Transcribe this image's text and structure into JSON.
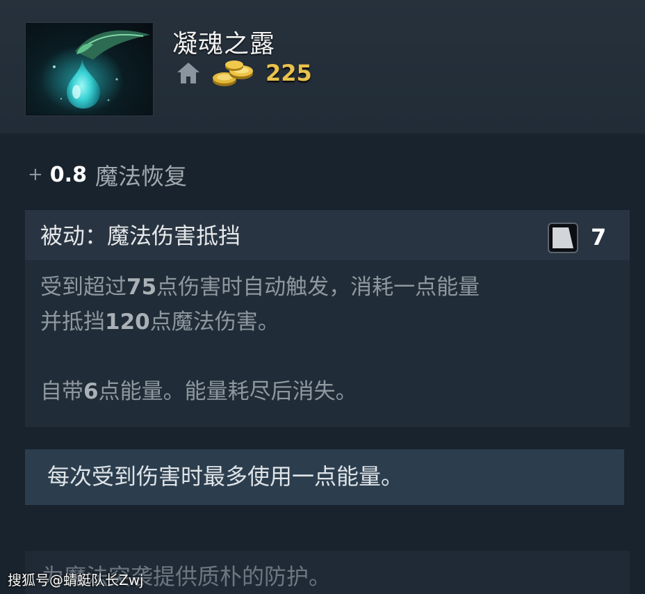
{
  "item": {
    "name": "凝魂之露",
    "cost": "225",
    "icons": {
      "shop": "home-icon",
      "gold": "gold-coins-icon",
      "image": "infused-raindrop-icon"
    }
  },
  "stat": {
    "plus": "+",
    "value": "0.8",
    "name": "魔法恢复"
  },
  "ability": {
    "title": "被动：魔法伤害抵挡",
    "cooldown": "7",
    "desc_line1": {
      "a": "受到超过",
      "b": "75",
      "c": "点伤害时自动触发，消耗一点能量"
    },
    "desc_line2": {
      "a": "并抵挡",
      "b": "120",
      "c": "点魔法伤害。"
    },
    "desc_line3": {
      "a": "自带",
      "b": "6",
      "c": "点能量。能量耗尽后消失。"
    }
  },
  "note": "每次受到伤害时最多使用一点能量。",
  "lore": "为魔法突袭提供质朴的防护。",
  "watermark": "搜狐号@蜻蜓队长Zwj",
  "colors": {
    "background": "#19232d",
    "gold": "#e9c24c",
    "note_panel": "#2c3e4e"
  }
}
